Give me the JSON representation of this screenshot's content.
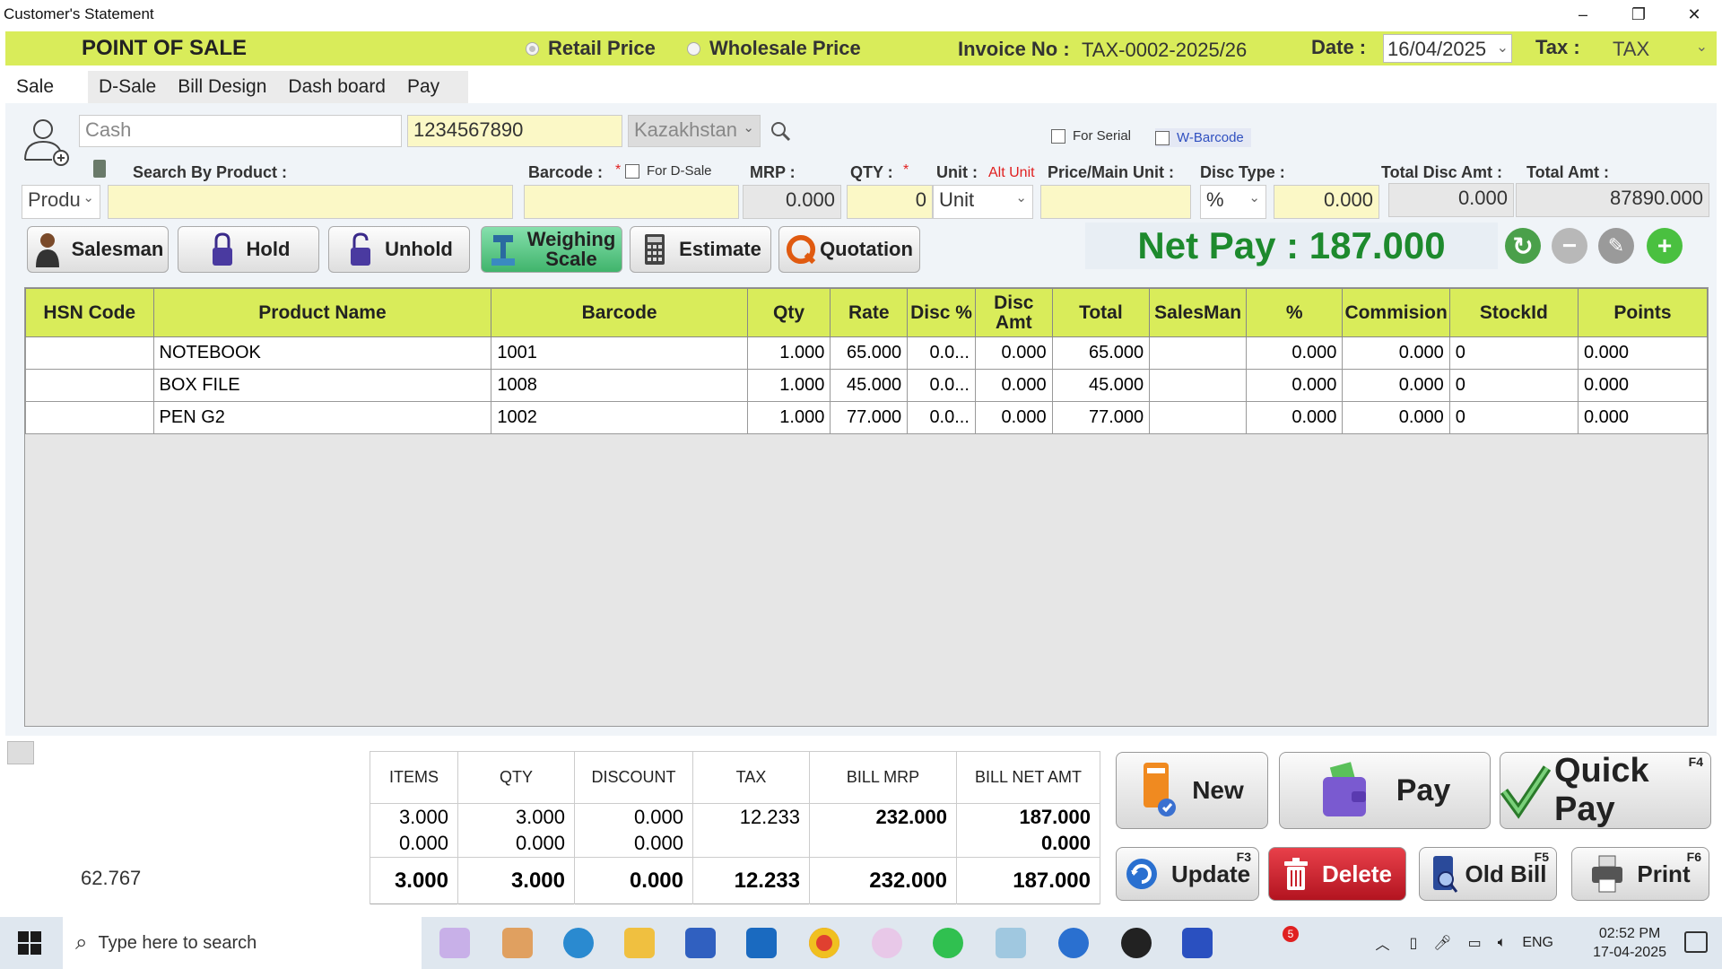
{
  "window": {
    "title": "Customer's Statement",
    "min": "–",
    "max": "❐",
    "close": "✕"
  },
  "header": {
    "title": "POINT OF SALE",
    "retail_label": "Retail Price",
    "wholesale_label": "Wholesale Price",
    "invoice_label": "Invoice No :",
    "invoice_value": "TAX-0002-2025/26",
    "date_label": "Date :",
    "date_value": "16/04/2025",
    "tax_label": "Tax :",
    "tax_value": "TAX"
  },
  "tabs": [
    "Sale",
    "D-Sale",
    "Bill Design",
    "Dash board",
    "Pay"
  ],
  "customer": {
    "name_placeholder": "Cash",
    "phone": "1234567890",
    "country": "Kazakhstan"
  },
  "options": {
    "for_serial": "For Serial",
    "w_barcode": "W-Barcode"
  },
  "entry": {
    "search_label": "Search By Product :",
    "search_mode": "Produ",
    "barcode_label": "Barcode :",
    "required_mark": "*",
    "for_dsale": "For D-Sale",
    "mrp_label": "MRP :",
    "mrp_value": "0.000",
    "qty_label": "QTY :",
    "qty_value": "0",
    "unit_label": "Unit :",
    "alt_unit": "Alt Unit",
    "unit_value": "Unit",
    "price_label": "Price/Main Unit :",
    "disc_type_label": "Disc Type :",
    "disc_type_value": "%",
    "disc_value": "0.000",
    "total_disc_label": "Total Disc Amt :",
    "total_disc_value": "0.000",
    "total_amt_label": "Total Amt :",
    "total_amt_value": "87890.000"
  },
  "actions": {
    "salesman": "Salesman",
    "hold": "Hold",
    "unhold": "Unhold",
    "weighing_line1": "Weighing",
    "weighing_line2": "Scale",
    "estimate": "Estimate",
    "quotation": "Quotation"
  },
  "net_pay": "Net Pay : 187.000",
  "grid": {
    "columns": [
      "HSN Code",
      "Product Name",
      "Barcode",
      "Qty",
      "Rate",
      "Disc %",
      "Disc Amt",
      "Total",
      "SalesMan",
      "%",
      "Commision",
      "StockId",
      "Points"
    ],
    "rows": [
      [
        "",
        "NOTEBOOK",
        "1001",
        "1.000",
        "65.000",
        "0.0...",
        "0.000",
        "65.000",
        "",
        "0.000",
        "0.000",
        "0",
        "0.000"
      ],
      [
        "",
        "BOX FILE",
        "1008",
        "1.000",
        "45.000",
        "0.0...",
        "0.000",
        "45.000",
        "",
        "0.000",
        "0.000",
        "0",
        "0.000"
      ],
      [
        "",
        "PEN G2",
        "1002",
        "1.000",
        "77.000",
        "0.0...",
        "0.000",
        "77.000",
        "",
        "0.000",
        "0.000",
        "0",
        "0.000"
      ]
    ]
  },
  "summary": {
    "columns": [
      "ITEMS",
      "QTY",
      "DISCOUNT",
      "TAX",
      "BILL MRP",
      "BILL NET AMT"
    ],
    "rows": [
      [
        "3.000",
        "3.000",
        "0.000",
        "12.233",
        "232.000",
        "187.000"
      ],
      [
        "0.000",
        "0.000",
        "0.000",
        "",
        "",
        "0.000"
      ]
    ],
    "totals": [
      "3.000",
      "3.000",
      "0.000",
      "12.233",
      "232.000",
      "187.000"
    ]
  },
  "side_value": "62.767",
  "bottom_buttons": {
    "new": "New",
    "pay": "Pay",
    "quick_pay": "Quick Pay",
    "quick_pay_key": "F4",
    "update": "Update",
    "update_key": "F3",
    "delete": "Delete",
    "old_bill": "Old Bill",
    "old_bill_key": "F5",
    "print": "Print",
    "print_key": "F6"
  },
  "taskbar": {
    "search_placeholder": "Type here to search",
    "lang": "ENG",
    "time": "02:52 PM",
    "date": "17-04-2025",
    "badge": "5"
  },
  "colors": {
    "header_yellow": "#d9ec5a",
    "net_pay_green": "#1d8a2d",
    "input_yellow": "#fbf8c6",
    "delete_red": "#c8202a"
  }
}
